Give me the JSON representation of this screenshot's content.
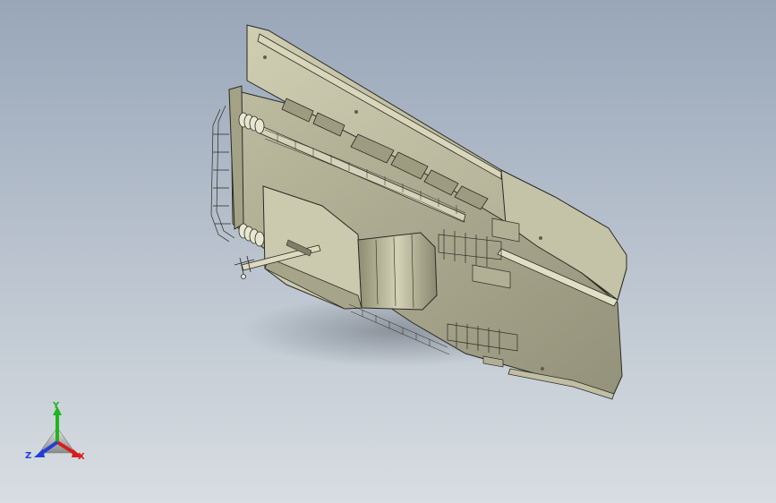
{
  "viewport": {
    "background_top": "#98a6b8",
    "background_bottom": "#d7dde2",
    "model": {
      "body_color": "#b8b79a",
      "face_light": "#c9c8ac",
      "face_dark": "#8f8e74",
      "edge_color": "#2a2a22"
    }
  },
  "triad": {
    "x_label": "X",
    "y_label": "Y",
    "z_label": "Z",
    "x_color": "#d81c1c",
    "y_color": "#1fb51f",
    "z_color": "#1f3fd8"
  }
}
